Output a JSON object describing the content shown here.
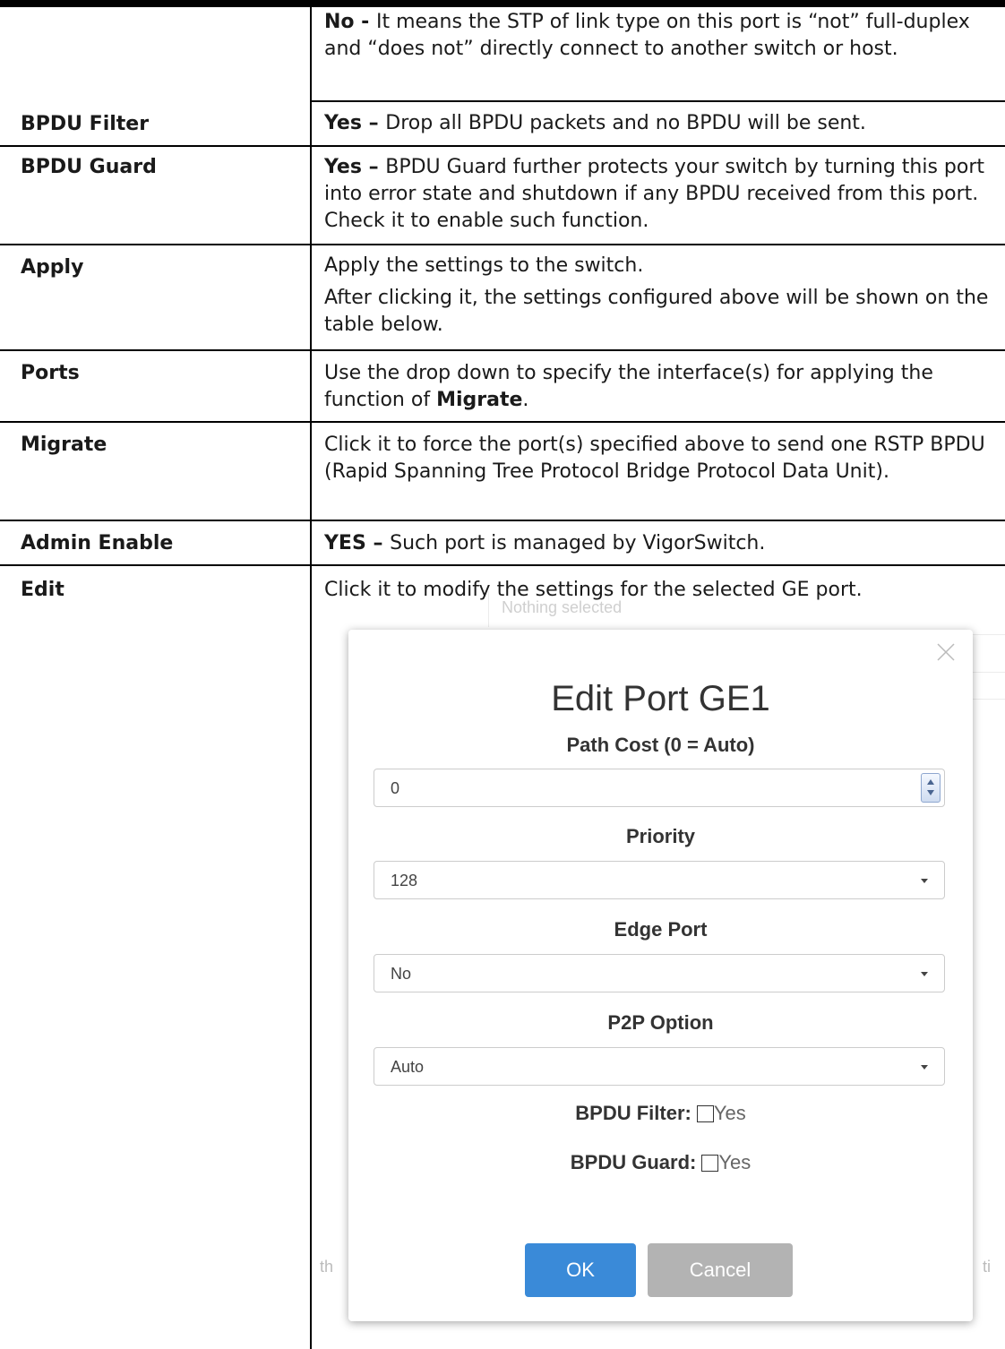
{
  "rows": [
    {
      "label": "",
      "desc_parts": [
        {
          "b": "No - "
        },
        {
          "t": "It means the STP of link type on this port is “not” full-duplex and “does not” directly connect to another switch or host."
        }
      ]
    },
    {
      "label": "BPDU Filter",
      "desc_parts": [
        {
          "b": "Yes – "
        },
        {
          "t": "Drop all BPDU packets and no BPDU will be sent."
        }
      ]
    },
    {
      "label": "BPDU Guard",
      "desc_parts": [
        {
          "b": "Yes – "
        },
        {
          "t": "BPDU Guard further protects your switch by turning this port into error state and shutdown if any BPDU received from this port. Check it to enable such function."
        }
      ]
    },
    {
      "label": "Apply",
      "p1": "Apply the settings to the switch.",
      "p2": "After clicking it, the settings configured above will be shown on the table below."
    },
    {
      "label": "Ports",
      "desc_parts": [
        {
          "t": "Use the drop down to specify the interface(s) for applying the function of "
        },
        {
          "b": "Migrate"
        },
        {
          "t": "."
        }
      ]
    },
    {
      "label": "Migrate",
      "desc_parts": [
        {
          "t": "Click it to force the port(s) specified above to send one RSTP BPDU (Rapid Spanning Tree Protocol Bridge Protocol Data Unit)."
        }
      ]
    },
    {
      "label": "Admin Enable",
      "desc_parts": [
        {
          "b": "YES – "
        },
        {
          "t": "Such port is managed by VigorSwitch."
        }
      ]
    },
    {
      "label": "Edit",
      "desc_parts": [
        {
          "t": "Click it to modify the settings for the selected GE port."
        }
      ]
    }
  ],
  "background": {
    "top_text": "Nothing selected",
    "left_frag": "th",
    "right_frag": "ti"
  },
  "modal": {
    "title": "Edit Port GE1",
    "path_cost": {
      "label": "Path Cost (0 = Auto)",
      "value": "0"
    },
    "priority": {
      "label": "Priority",
      "value": "128"
    },
    "edge_port": {
      "label": "Edge Port",
      "value": "No"
    },
    "p2p": {
      "label": "P2P Option",
      "value": "Auto"
    },
    "bpdu_filter": {
      "label": "BPDU Filter:",
      "option": "Yes"
    },
    "bpdu_guard": {
      "label": "BPDU Guard:",
      "option": "Yes"
    },
    "ok_label": "OK",
    "cancel_label": "Cancel"
  }
}
